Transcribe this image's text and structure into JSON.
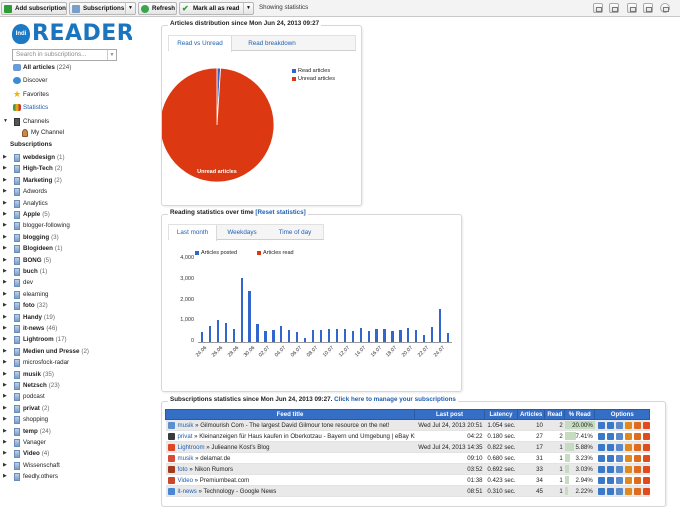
{
  "toolbar": {
    "add_subscription": "Add subscription",
    "subscriptions": "Subscriptions",
    "refresh": "Refresh",
    "mark_all_read": "Mark all as read",
    "status": "Showing statistics"
  },
  "sidebar": {
    "logo_badge": "Indi",
    "logo_text": "READER",
    "search_placeholder": "Search in subscriptions...",
    "nav": [
      {
        "label": "All articles",
        "count": "(224)"
      },
      {
        "label": "Discover"
      },
      {
        "label": "Favorites"
      },
      {
        "label": "Statistics"
      }
    ],
    "channels_label": "Channels",
    "channel_item": "My Channel",
    "subscriptions_label": "Subscriptions",
    "subscriptions": [
      {
        "label": "webdesign",
        "count": "(1)",
        "bold": true
      },
      {
        "label": "High-Tech",
        "count": "(2)",
        "bold": true
      },
      {
        "label": "Marketing",
        "count": "(2)",
        "bold": true
      },
      {
        "label": "Adwords",
        "count": "",
        "bold": false
      },
      {
        "label": "Analytics",
        "count": "",
        "bold": false
      },
      {
        "label": "Apple",
        "count": "(5)",
        "bold": true
      },
      {
        "label": "blogger-following",
        "count": "",
        "bold": false
      },
      {
        "label": "blogging",
        "count": "(3)",
        "bold": true
      },
      {
        "label": "Blogideen",
        "count": "(1)",
        "bold": true
      },
      {
        "label": "BONG",
        "count": "(5)",
        "bold": true
      },
      {
        "label": "buch",
        "count": "(1)",
        "bold": true
      },
      {
        "label": "dev",
        "count": "",
        "bold": false
      },
      {
        "label": "elearning",
        "count": "",
        "bold": false
      },
      {
        "label": "foto",
        "count": "(32)",
        "bold": true
      },
      {
        "label": "Handy",
        "count": "(19)",
        "bold": true
      },
      {
        "label": "it-news",
        "count": "(46)",
        "bold": true
      },
      {
        "label": "Lightroom",
        "count": "(17)",
        "bold": true
      },
      {
        "label": "Medien und Presse",
        "count": "(2)",
        "bold": true
      },
      {
        "label": "microsfock-radar",
        "count": "",
        "bold": false
      },
      {
        "label": "musik",
        "count": "(35)",
        "bold": true
      },
      {
        "label": "Netzsch",
        "count": "(23)",
        "bold": true
      },
      {
        "label": "podcast",
        "count": "",
        "bold": false
      },
      {
        "label": "privat",
        "count": "(2)",
        "bold": true
      },
      {
        "label": "shopping",
        "count": "",
        "bold": false
      },
      {
        "label": "temp",
        "count": "(24)",
        "bold": true
      },
      {
        "label": "Vanager",
        "count": "",
        "bold": false
      },
      {
        "label": "Video",
        "count": "(4)",
        "bold": true
      },
      {
        "label": "Wissenschaft",
        "count": "",
        "bold": false
      },
      {
        "label": "feedly.others",
        "count": "",
        "bold": false
      }
    ]
  },
  "distribution": {
    "title": "Articles distribution since Mon Jun 24, 2013 09:27",
    "tabs": [
      "Read vs Unread",
      "Read breakdown"
    ],
    "legend": [
      "Read articles",
      "Unread articles"
    ],
    "slice_label": "Unread articles"
  },
  "reading": {
    "title": "Reading statistics over time",
    "reset_link": "[Reset statistics]",
    "tabs": [
      "Last month",
      "Weekdays",
      "Time of day"
    ]
  },
  "colors": {
    "posted": "#3366cc",
    "read": "#dc3912",
    "header": "#356ec5",
    "accent": "#1f5fb1"
  },
  "chart_data": [
    {
      "type": "pie",
      "title": "",
      "categories": [
        "Read articles",
        "Unread articles"
      ],
      "values": [
        1,
        99
      ],
      "slice_labels": [
        "",
        "Unread articles"
      ],
      "legend_position": "top-right"
    },
    {
      "type": "bar",
      "title": "",
      "ylim": [
        0,
        4000
      ],
      "yticks": [
        "4,000",
        "3,000",
        "2,000",
        "1,000",
        "0"
      ],
      "categories": [
        "24.06",
        "25.06",
        "26.06",
        "27.06",
        "28.06",
        "29.06",
        "30.06",
        "01.07",
        "02.07",
        "03.07",
        "04.07",
        "05.07",
        "06.07",
        "07.07",
        "08.07",
        "09.07",
        "10.07",
        "11.07",
        "12.07",
        "13.07",
        "14.07",
        "15.07",
        "16.07",
        "17.07",
        "18.07",
        "19.07",
        "20.07",
        "21.07",
        "22.07",
        "23.07",
        "24.07",
        "25.07"
      ],
      "xtick_labels": [
        "24.06",
        "26.06",
        "28.06",
        "30.06",
        "02.07",
        "04.07",
        "06.07",
        "08.07",
        "10.07",
        "12.07",
        "14.07",
        "16.07",
        "18.07",
        "20.07",
        "22.07",
        "24.07"
      ],
      "series": [
        {
          "name": "Articles posted",
          "values": [
            480,
            760,
            1060,
            930,
            650,
            3080,
            2450,
            870,
            530,
            560,
            780,
            560,
            480,
            200,
            590,
            590,
            650,
            640,
            640,
            530,
            660,
            540,
            640,
            640,
            540,
            570,
            670,
            560,
            340,
            710,
            1590,
            420
          ]
        },
        {
          "name": "Articles read",
          "values": [
            0,
            0,
            0,
            0,
            0,
            0,
            0,
            0,
            0,
            0,
            0,
            0,
            0,
            0,
            0,
            0,
            0,
            0,
            0,
            0,
            0,
            0,
            0,
            0,
            0,
            0,
            0,
            0,
            0,
            0,
            0,
            0
          ]
        }
      ],
      "legend_position": "top"
    }
  ],
  "table": {
    "title": "Subscriptions statistics since Mon Jun 24, 2013 09:27.",
    "manage_link": "Click here to manage your subscriptions",
    "headers": [
      "Feed title",
      "Last post",
      "Latency",
      "Articles",
      "Read",
      "% Read",
      "Options"
    ],
    "rows": [
      {
        "folder": "musik",
        "feed": "Gilmourish Com - The largest David Gilmour tone resource on the net!",
        "last": "Wed Jul 24, 2013 20:51",
        "latency": "1.054 sec.",
        "articles": "10",
        "read": "2",
        "pct": "20.00%",
        "pct_value": 20,
        "icon": "#5b8fd0"
      },
      {
        "folder": "privat",
        "feed": "Kleinanzeigen für Haus kaufen in Oberkotzau - Bayern und Umgebung | eBay Kleinanzeigen",
        "last": "04:22",
        "latency": "0.180 sec.",
        "articles": "27",
        "read": "2",
        "pct": "7.41%",
        "pct_value": 7.41,
        "icon": "#3a3a3a"
      },
      {
        "folder": "Lightroom",
        "feed": "Julieanne Kost's Blog",
        "last": "Wed Jul 24, 2013 14:35",
        "latency": "0.822 sec.",
        "articles": "17",
        "read": "1",
        "pct": "5.88%",
        "pct_value": 5.88,
        "icon": "#e0461f"
      },
      {
        "folder": "musik",
        "feed": "delamar.de",
        "last": "09:10",
        "latency": "0.680 sec.",
        "articles": "31",
        "read": "1",
        "pct": "3.23%",
        "pct_value": 3.23,
        "icon": "#d94a3a"
      },
      {
        "folder": "foto",
        "feed": "Nikon Rumors",
        "last": "03:52",
        "latency": "0.692 sec.",
        "articles": "33",
        "read": "1",
        "pct": "3.03%",
        "pct_value": 3.03,
        "icon": "#a33b1f"
      },
      {
        "folder": "Video",
        "feed": "Premiumbeat.com",
        "last": "01:38",
        "latency": "0.423 sec.",
        "articles": "34",
        "read": "1",
        "pct": "2.94%",
        "pct_value": 2.94,
        "icon": "#c9482c"
      },
      {
        "folder": "it-news",
        "feed": "Technology - Google News",
        "last": "08:51",
        "latency": "0.310 sec.",
        "articles": "45",
        "read": "1",
        "pct": "2.22%",
        "pct_value": 2.22,
        "icon": "#4a86d8"
      }
    ]
  }
}
